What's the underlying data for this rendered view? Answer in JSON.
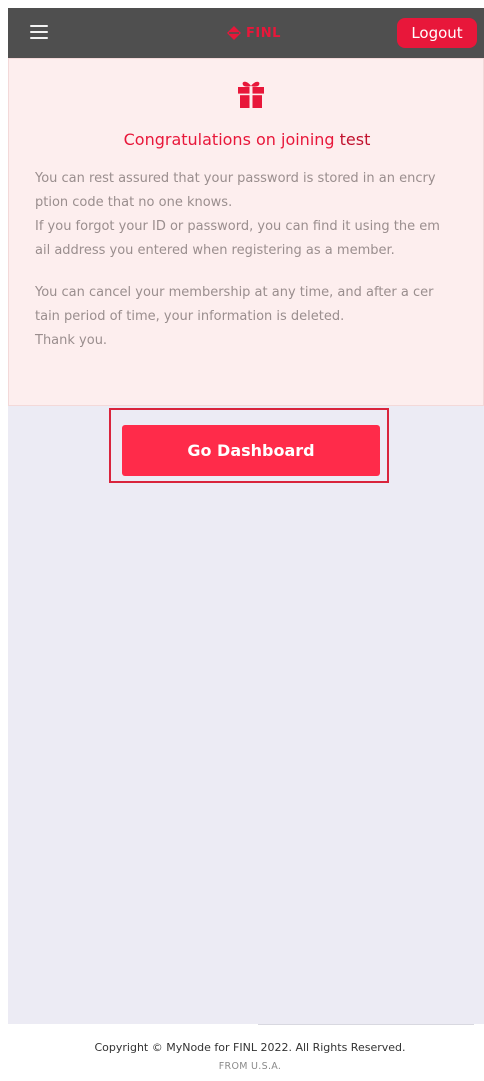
{
  "header": {
    "brand_name": "FINL",
    "logout_label": "Logout",
    "accent_color": "#e8173a"
  },
  "card": {
    "icon": "gift-icon",
    "title_prefix": "Congratulations on joining ",
    "title_user": "test",
    "paragraph_1_lines": [
      "You can rest assured that your password is stored in an encry",
      "ption code that no one knows.",
      "If you forgot your ID or password, you can find it using the em",
      "ail address you entered when registering as a member."
    ],
    "paragraph_2_lines": [
      "You can cancel your membership at any time, and after a cer",
      "tain period of time, your information is deleted.",
      "Thank you."
    ]
  },
  "main": {
    "dashboard_button_label": "Go Dashboard"
  },
  "footer": {
    "copyright": "Copyright © MyNode for FINL 2022. All Rights Reserved.",
    "origin": "FROM U.S.A."
  }
}
